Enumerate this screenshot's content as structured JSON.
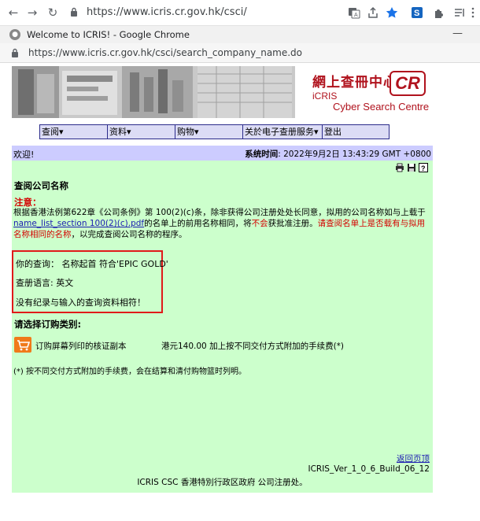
{
  "browser": {
    "url": "https://www.icris.cr.gov.hk/csci/"
  },
  "popup": {
    "title": "Welcome to ICRIS! - Google Chrome",
    "url": "https://www.icris.cr.gov.hk/csci/search_company_name.do"
  },
  "banner": {
    "logo_zh": "網上查冊中心",
    "logo_icris": "iCRIS",
    "logo_cr": "CR",
    "logo_en": "Cyber Search Centre"
  },
  "menu": [
    {
      "label": "查阅▾"
    },
    {
      "label": "资料▾"
    },
    {
      "label": "购物▾"
    },
    {
      "label": "关於电子查册服务▾"
    },
    {
      "label": "登出"
    }
  ],
  "header": {
    "welcome": "欢迎!",
    "systime_label": "系统时间",
    "systime_value": ": 2022年9月2日 13:43:29 GMT +0800"
  },
  "section": {
    "title": "查阅公司名称",
    "note_label": "注意：",
    "note_1": "根据香港法例第622章《公司条例》第 100(2)(c)条，除非获得公司注册处处长同意，拟用的公司名称如与上载于",
    "note_link": "name_list_section 100(2)(c).pdf",
    "note_2": "的名单上的前用名称相同，将",
    "note_not": "不会",
    "note_3": "获批准注册。",
    "note_red": "请查阅名单上是否载有与拟用名称相同的名称",
    "note_4": "，以完成查阅公司名称的程序。"
  },
  "query": {
    "line1": "你的查询： 名称起首 符合'EPIC GOLD'",
    "line2": "查册语言: 英文",
    "line3": "没有纪录与输入的查询资料相符！"
  },
  "order": {
    "title": "请选择订购类别:",
    "item": "订购屏幕列印的核证副本",
    "price": "港元140.00 加上按不同交付方式附加的手续费(*)",
    "fee_note": "(*) 按不同交付方式附加的手续费，会在结算和清付购物篮时列明。"
  },
  "footer": {
    "back_top": "返回页顶",
    "version": "ICRIS_Ver_1_0_6_Build_06_12",
    "copyright": "ICRIS CSC 香港特別行政区政府 公司注册处。"
  },
  "colors": {
    "menu_bg": "#dcdcf5",
    "content_bg": "#ccffcc",
    "welcome_bg": "#ccccff",
    "highlight": "#e01a1a"
  }
}
